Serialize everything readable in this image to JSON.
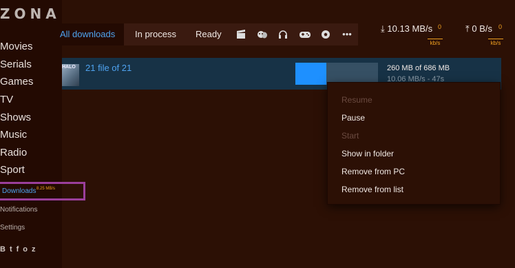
{
  "app": {
    "logo": "ZONA"
  },
  "sidebar": {
    "items": [
      {
        "label": "Movies"
      },
      {
        "label": "Serials"
      },
      {
        "label": "Games"
      },
      {
        "label": "TV"
      },
      {
        "label": "Shows"
      },
      {
        "label": "Music"
      },
      {
        "label": "Radio"
      },
      {
        "label": "Sport"
      }
    ],
    "downloads": {
      "label": "Downloads",
      "badge": "8.25 MB/s"
    },
    "notifications": "Notifications",
    "settings": "Settings",
    "social": [
      "B",
      "t",
      "f",
      "o",
      "z"
    ]
  },
  "tabs": {
    "all": "All downloads",
    "in_process": "In process",
    "ready": "Ready",
    "icons": [
      "film-icon",
      "theater-masks-icon",
      "headphones-icon",
      "gamepad-icon",
      "football-icon",
      "more-icon"
    ],
    "more": "•••"
  },
  "speed": {
    "download": "10.13 MB/s",
    "download_limit": "0",
    "upload": "0 B/s",
    "upload_limit": "0",
    "unit": "kb/s"
  },
  "download_row": {
    "title": "21 file of 21",
    "thumb_text": "HALO",
    "size": "260 MB of 686 MB",
    "rate": "10.06 MB/s - 47s",
    "progress": 0.379
  },
  "context_menu": {
    "resume": "Resume",
    "pause": "Pause",
    "start": "Start",
    "show_in_folder": "Show in folder",
    "remove_from_pc": "Remove from PC",
    "remove_from_list": "Remove from list"
  },
  "colors": {
    "accent": "#4fa3f0",
    "orange": "#f0a020",
    "background": "#2c1005",
    "highlight": "#9b3f9b"
  }
}
